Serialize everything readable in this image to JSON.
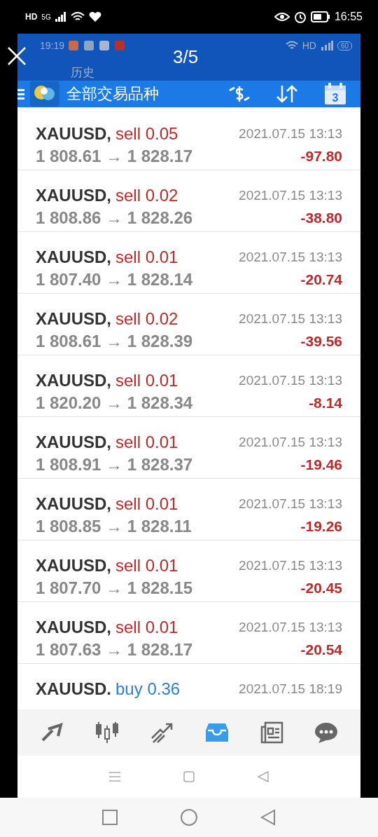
{
  "outer_status_bar": {
    "network": "HD",
    "network_type": "5G",
    "time": "16:55"
  },
  "viewer": {
    "counter": "3/5"
  },
  "inner_status_bar": {
    "time": "19:19",
    "network": "HD",
    "battery": "60"
  },
  "header": {
    "subtitle": "历史",
    "title": "全部交易品种",
    "calendar_day": "3"
  },
  "trades": [
    {
      "symbol": "XAUUSD,",
      "kind": "sell",
      "side": "sell",
      "volume": "0.05",
      "time": "2021.07.15 13:13",
      "prices": "1 808.61 → 1 828.17",
      "profit": "-97.80"
    },
    {
      "symbol": "XAUUSD,",
      "kind": "sell",
      "side": "sell",
      "volume": "0.02",
      "time": "2021.07.15 13:13",
      "prices": "1 808.86 → 1 828.26",
      "profit": "-38.80"
    },
    {
      "symbol": "XAUUSD,",
      "kind": "sell",
      "side": "sell",
      "volume": "0.01",
      "time": "2021.07.15 13:13",
      "prices": "1 807.40 → 1 828.14",
      "profit": "-20.74"
    },
    {
      "symbol": "XAUUSD,",
      "kind": "sell",
      "side": "sell",
      "volume": "0.02",
      "time": "2021.07.15 13:13",
      "prices": "1 808.61 → 1 828.39",
      "profit": "-39.56"
    },
    {
      "symbol": "XAUUSD,",
      "kind": "sell",
      "side": "sell",
      "volume": "0.01",
      "time": "2021.07.15 13:13",
      "prices": "1 820.20 → 1 828.34",
      "profit": "-8.14"
    },
    {
      "symbol": "XAUUSD,",
      "kind": "sell",
      "side": "sell",
      "volume": "0.01",
      "time": "2021.07.15 13:13",
      "prices": "1 808.91 → 1 828.37",
      "profit": "-19.46"
    },
    {
      "symbol": "XAUUSD,",
      "kind": "sell",
      "side": "sell",
      "volume": "0.01",
      "time": "2021.07.15 13:13",
      "prices": "1 808.85 → 1 828.11",
      "profit": "-19.26"
    },
    {
      "symbol": "XAUUSD,",
      "kind": "sell",
      "side": "sell",
      "volume": "0.01",
      "time": "2021.07.15 13:13",
      "prices": "1 807.70 → 1 828.15",
      "profit": "-20.45"
    },
    {
      "symbol": "XAUUSD,",
      "kind": "sell",
      "side": "sell",
      "volume": "0.01",
      "time": "2021.07.15 13:13",
      "prices": "1 807.63 → 1 828.17",
      "profit": "-20.54"
    },
    {
      "symbol": "XAUUSD.",
      "kind": "buy",
      "side": "buy",
      "volume": "0.36",
      "time": "2021.07.15 18:19"
    }
  ],
  "tabs": [
    {
      "kind": "trade",
      "selected": false
    },
    {
      "kind": "quotes",
      "selected": false
    },
    {
      "kind": "chart",
      "selected": false
    },
    {
      "kind": "history",
      "selected": true
    },
    {
      "kind": "news",
      "selected": false
    },
    {
      "kind": "chat",
      "selected": false
    }
  ]
}
